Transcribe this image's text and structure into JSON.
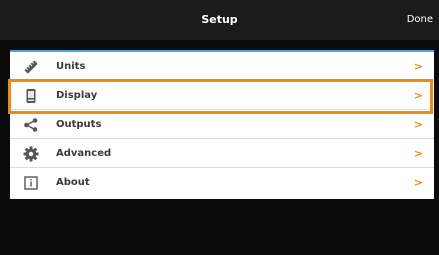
{
  "header": {
    "title": "Setup",
    "done_label": "Done"
  },
  "menu": {
    "items": [
      {
        "label": "Units",
        "icon": "ruler-icon",
        "chevron": ">"
      },
      {
        "label": "Display",
        "icon": "device-icon",
        "chevron": ">"
      },
      {
        "label": "Outputs",
        "icon": "share-icon",
        "chevron": ">"
      },
      {
        "label": "Advanced",
        "icon": "gear-icon",
        "chevron": ">"
      },
      {
        "label": "About",
        "icon": "info-icon",
        "chevron": ">"
      }
    ]
  },
  "colors": {
    "accent": "#f08a12",
    "separator_blue": "#4da3e8",
    "header_bg": "#1b1b1b",
    "background": "#0b0b0b"
  }
}
